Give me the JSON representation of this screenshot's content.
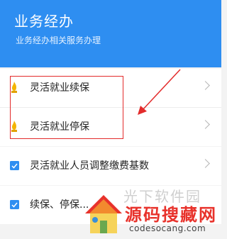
{
  "header": {
    "title": "业务经办",
    "subtitle": "业务经办相关服务办理"
  },
  "items": [
    {
      "label": "灵活就业续保",
      "icon": "flame-icon"
    },
    {
      "label": "灵活就业停保",
      "icon": "flame-icon"
    },
    {
      "label": "灵活就业人员调整缴费基数",
      "icon": "document-icon"
    },
    {
      "label": "续保、停保...",
      "icon": "document-icon"
    }
  ],
  "watermark": {
    "faint_text": "光下软件园",
    "brand": "源码搜藏网",
    "url": "codesocang.com"
  },
  "colors": {
    "header": "#2e8ef1",
    "annotation": "#e32b2b"
  }
}
